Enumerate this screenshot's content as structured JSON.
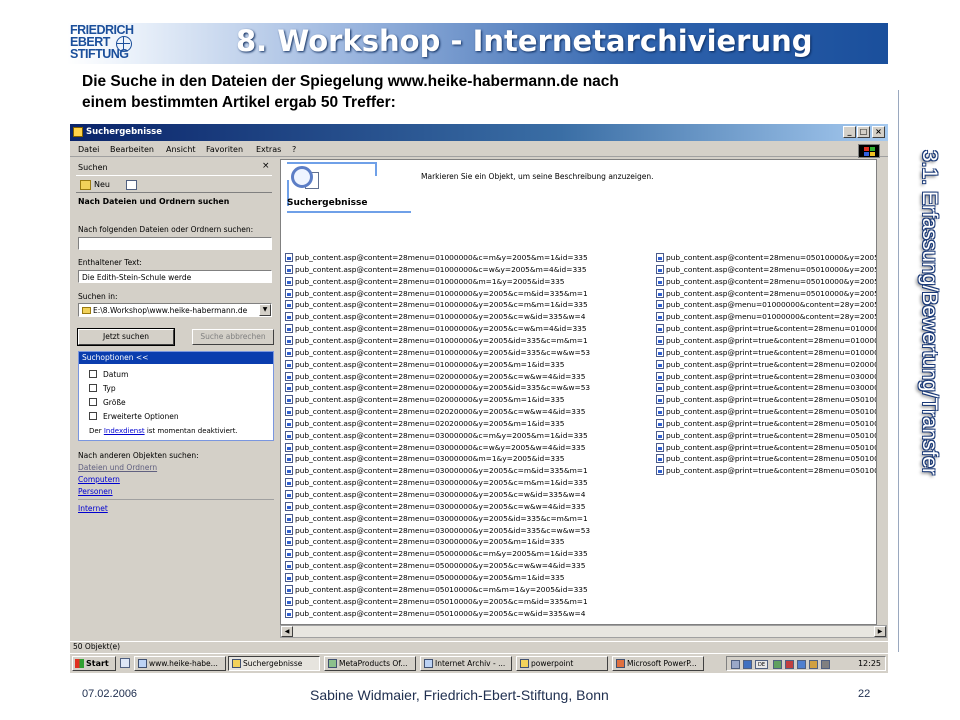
{
  "slide": {
    "logo_lines": [
      "FRIEDRICH",
      "EBERT",
      "STIFTUNG"
    ],
    "title": "8. Workshop - Internetarchivierung",
    "side_title": "3.1. Erfassung/Bewertung/Transfer",
    "intro_line1": "Die Suche in den Dateien der Spiegelung www.heike-habermann.de nach",
    "intro_line2": "einem bestimmten Artikel ergab 50 Treffer:",
    "footer_date": "07.02.2006",
    "footer_author": "Sabine Widmaier, Friedrich-Ebert-Stiftung, Bonn",
    "footer_page": "22"
  },
  "window": {
    "title": "Suchergebnisse",
    "controls": [
      "_",
      "□",
      "×"
    ],
    "menu": [
      "Datei",
      "Bearbeiten",
      "Ansicht",
      "Favoriten",
      "Extras",
      "?"
    ]
  },
  "search_panel": {
    "header": "Suchen",
    "close": "×",
    "new_label": "Neu",
    "find_title": "Nach Dateien und Ordnern suchen",
    "files_label": "Nach folgenden Dateien oder Ordnern suchen:",
    "files_value": "",
    "text_label": "Enthaltener Text:",
    "text_value": "Die Edith-Stein-Schule werde",
    "lookin_label": "Suchen in:",
    "lookin_value": "E:\\8.Workshop\\www.heike-habermann.de",
    "search_now": "Jetzt suchen",
    "stop_search": "Suche abbrechen",
    "options_header": "Suchoptionen  <<",
    "options": [
      "Datum",
      "Typ",
      "Größe",
      "Erweiterte Optionen"
    ],
    "index_note_pre": "Der ",
    "index_note_link": "Indexdienst",
    "index_note_post": " ist momentan deaktiviert.",
    "other_label": "Nach anderen Objekten suchen:",
    "other_links": [
      "Dateien und Ordnern",
      "Computern",
      "Personen"
    ],
    "internet_link": "Internet"
  },
  "results": {
    "title": "Suchergebnisse",
    "hint": "Markieren Sie ein Objekt, um seine Beschreibung anzuzeigen.",
    "left_column": [
      "pub_content.asp@content=28menu=01000000&c=m&y=2005&m=1&id=335",
      "pub_content.asp@content=28menu=01000000&c=w&y=2005&m=4&id=335",
      "pub_content.asp@content=28menu=01000000&m=1&y=2005&id=335",
      "pub_content.asp@content=28menu=01000000&y=2005&c=m&id=335&m=1",
      "pub_content.asp@content=28menu=01000000&y=2005&c=m&m=1&id=335",
      "pub_content.asp@content=28menu=01000000&y=2005&c=w&id=335&w=4",
      "pub_content.asp@content=28menu=01000000&y=2005&c=w&m=4&id=335",
      "pub_content.asp@content=28menu=01000000&y=2005&id=335&c=m&m=1",
      "pub_content.asp@content=28menu=01000000&y=2005&id=335&c=w&w=53",
      "pub_content.asp@content=28menu=01000000&y=2005&m=1&id=335",
      "pub_content.asp@content=28menu=02000000&y=2005&c=w&w=4&id=335",
      "pub_content.asp@content=28menu=02000000&y=2005&id=335&c=w&w=53",
      "pub_content.asp@content=28menu=02000000&y=2005&m=1&id=335",
      "pub_content.asp@content=28menu=02020000&y=2005&c=w&w=4&id=335",
      "pub_content.asp@content=28menu=02020000&y=2005&m=1&id=335",
      "pub_content.asp@content=28menu=03000000&c=m&y=2005&m=1&id=335",
      "pub_content.asp@content=28menu=03000000&c=w&y=2005&w=4&id=335",
      "pub_content.asp@content=28menu=03000000&m=1&y=2005&id=335",
      "pub_content.asp@content=28menu=03000000&y=2005&c=m&id=335&m=1",
      "pub_content.asp@content=28menu=03000000&y=2005&c=m&m=1&id=335",
      "pub_content.asp@content=28menu=03000000&y=2005&c=w&id=335&w=4",
      "pub_content.asp@content=28menu=03000000&y=2005&c=w&w=4&id=335",
      "pub_content.asp@content=28menu=03000000&y=2005&id=335&c=m&m=1",
      "pub_content.asp@content=28menu=03000000&y=2005&id=335&c=w&w=53",
      "pub_content.asp@content=28menu=03000000&y=2005&m=1&id=335",
      "pub_content.asp@content=28menu=05000000&c=m&y=2005&m=1&id=335",
      "pub_content.asp@content=28menu=05000000&y=2005&c=w&w=4&id=335",
      "pub_content.asp@content=28menu=05000000&y=2005&m=1&id=335",
      "pub_content.asp@content=28menu=05010000&c=m&m=1&y=2005&id=335",
      "pub_content.asp@content=28menu=05010000&y=2005&c=m&id=335&m=1",
      "pub_content.asp@content=28menu=05010000&y=2005&c=w&id=335&w=4"
    ],
    "right_column": [
      "pub_content.asp@content=28menu=05010000&y=2005",
      "pub_content.asp@content=28menu=05010000&y=2005",
      "pub_content.asp@content=28menu=05010000&y=2005",
      "pub_content.asp@content=28menu=05010000&y=2005",
      "pub_content.asp@menu=01000000&content=28y=2005",
      "pub_content.asp@menu=01000000&content=28y=2005",
      "pub_content.asp@print=true&content=28menu=010000",
      "pub_content.asp@print=true&content=28menu=010000",
      "pub_content.asp@print=true&content=28menu=010000",
      "pub_content.asp@print=true&content=28menu=020000",
      "pub_content.asp@print=true&content=28menu=030000",
      "pub_content.asp@print=true&content=28menu=030000",
      "pub_content.asp@print=true&content=28menu=050100",
      "pub_content.asp@print=true&content=28menu=050100",
      "pub_content.asp@print=true&content=28menu=050100",
      "pub_content.asp@print=true&content=28menu=050100",
      "pub_content.asp@print=true&content=28menu=050100",
      "pub_content.asp@print=true&content=28menu=050100",
      "pub_content.asp@print=true&content=28menu=050100"
    ]
  },
  "status_bar": "50 Objekt(e)",
  "taskbar": {
    "start": "Start",
    "buttons": [
      "www.heike-habe...",
      "Suchergebnisse",
      "MetaProducts Of...",
      "Internet Archiv - ...",
      "powerpoint",
      "Microsoft PowerP..."
    ],
    "tray_lang": "DE",
    "clock": "12:25"
  }
}
